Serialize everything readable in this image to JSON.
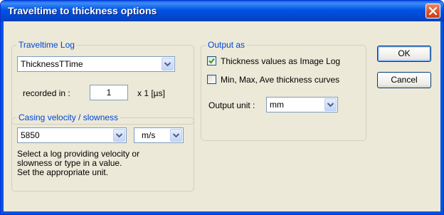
{
  "window": {
    "title": "Traveltime to thickness options"
  },
  "traveltime_log": {
    "legend": "Traveltime Log",
    "log_value": "ThicknessTTime",
    "recorded_label": "recorded in :",
    "recorded_value": "1",
    "recorded_unit": "x 1 [µs]"
  },
  "casing": {
    "legend": "Casing velocity / slowness",
    "velocity_value": "5850",
    "unit_value": "m/s",
    "description": [
      "Select a log providing velocity or",
      "slowness or type in a value.",
      "Set the appropriate unit."
    ]
  },
  "output": {
    "legend": "Output as",
    "thickness_image_label": "Thickness values as Image Log",
    "thickness_image_checked": true,
    "curves_label": "Min, Max, Ave thickness curves",
    "curves_checked": false,
    "unit_label": "Output unit :",
    "unit_value": "mm"
  },
  "buttons": {
    "ok": "OK",
    "cancel": "Cancel"
  }
}
